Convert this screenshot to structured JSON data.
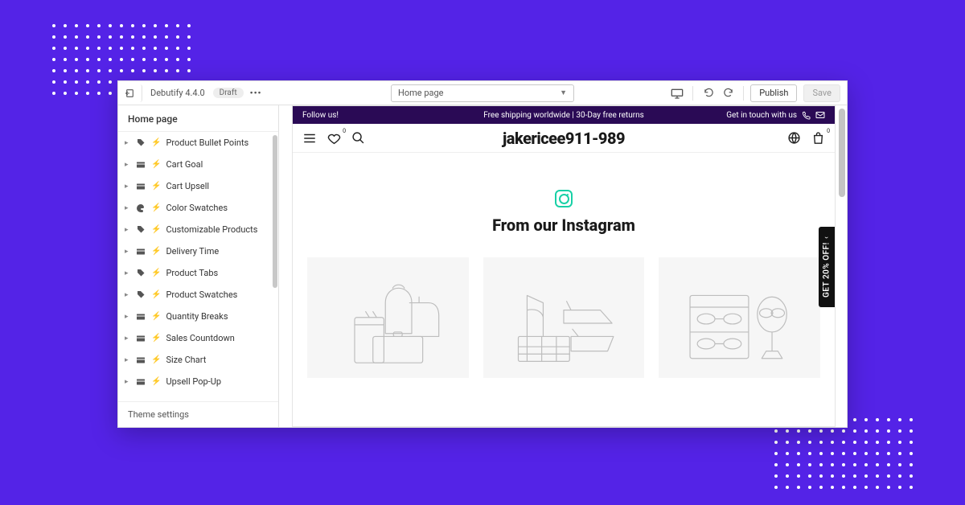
{
  "topbar": {
    "theme_name": "Debutify 4.4.0",
    "status": "Draft",
    "page_selector": "Home page",
    "publish_label": "Publish",
    "save_label": "Save"
  },
  "sidebar": {
    "title": "Home page",
    "items": [
      {
        "icon": "tag",
        "label": "Product Bullet Points"
      },
      {
        "icon": "section",
        "label": "Cart Goal"
      },
      {
        "icon": "section",
        "label": "Cart Upsell"
      },
      {
        "icon": "palette",
        "label": "Color Swatches"
      },
      {
        "icon": "tag",
        "label": "Customizable Products"
      },
      {
        "icon": "section",
        "label": "Delivery Time"
      },
      {
        "icon": "tag",
        "label": "Product Tabs"
      },
      {
        "icon": "tag",
        "label": "Product Swatches"
      },
      {
        "icon": "section",
        "label": "Quantity Breaks"
      },
      {
        "icon": "section",
        "label": "Sales Countdown"
      },
      {
        "icon": "section",
        "label": "Size Chart"
      },
      {
        "icon": "section",
        "label": "Upsell Pop-Up"
      }
    ],
    "footer": "Theme settings"
  },
  "preview": {
    "announce": {
      "left": "Follow us!",
      "mid": "Free shipping worldwide | 30-Day free returns",
      "right": "Get in touch with us"
    },
    "store_name": "jakericee911-989",
    "wishlist_count": "0",
    "bag_count": "0",
    "instagram_heading": "From our Instagram",
    "promo_text": "GET 20% OFF!"
  }
}
